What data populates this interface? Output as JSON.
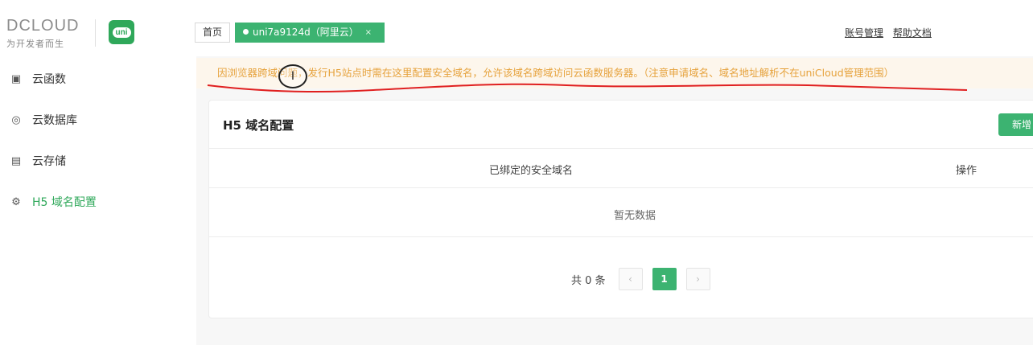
{
  "brand": {
    "logo_text": "DCLOUD",
    "logo_sub": "为开发者而生",
    "app_icon_text": "uni"
  },
  "tabs": {
    "home": "首页",
    "active": "uni7a9124d（阿里云）",
    "close": "×"
  },
  "header_links": {
    "account": "账号管理",
    "help": "帮助文档"
  },
  "sidebar": {
    "items": [
      {
        "label": "云函数",
        "icon": "cloud-function-icon"
      },
      {
        "label": "云数据库",
        "icon": "database-icon"
      },
      {
        "label": "云存储",
        "icon": "storage-icon"
      },
      {
        "label": "H5 域名配置",
        "icon": "settings-icon"
      }
    ]
  },
  "notice": "因浏览器跨域问题，发行H5站点时需在这里配置安全域名，允许该域名跨域访问云函数服务器。（注意申请域名、域名地址解析不在uniCloud管理范围）",
  "card": {
    "title": "H5 域名配置",
    "new_button": "新增",
    "col_domain": "已绑定的安全域名",
    "col_action": "操作",
    "empty_text": "暂无数据"
  },
  "pagination": {
    "total_text": "共 0 条",
    "prev": "‹",
    "current": "1",
    "next": "›"
  },
  "colors": {
    "accent": "#3cb371",
    "notice_text": "#e6a23c",
    "notice_bg": "#fdf6ec",
    "annotation": "#e02020"
  }
}
